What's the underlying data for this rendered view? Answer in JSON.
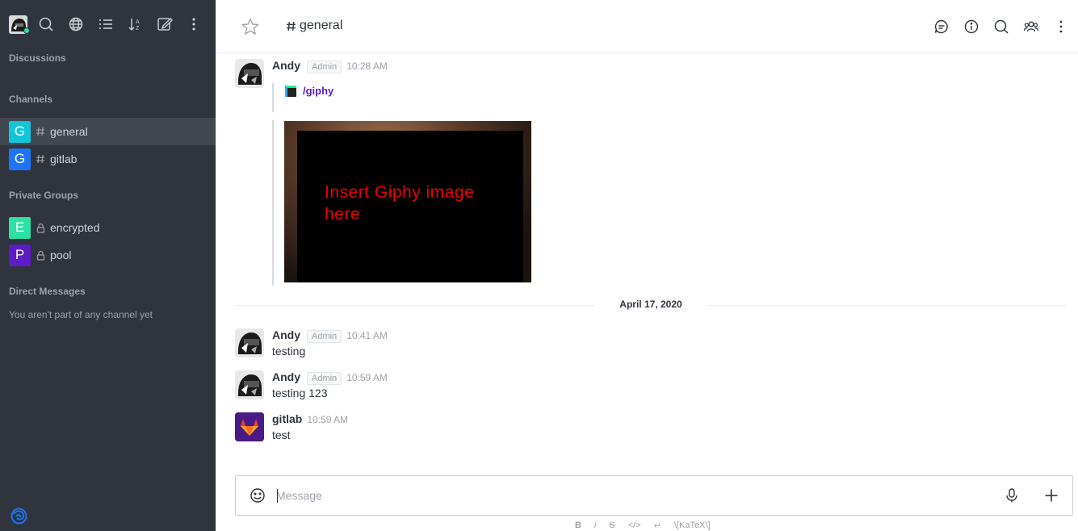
{
  "sidebar": {
    "sections": {
      "discussions": "Discussions",
      "channels": "Channels",
      "private_groups": "Private Groups",
      "direct_messages": "Direct Messages"
    },
    "channels": [
      {
        "badge": "G",
        "label": "general",
        "color": "#12c5d9",
        "active": true
      },
      {
        "badge": "G",
        "label": "gitlab",
        "color": "#1d74f5",
        "active": false
      }
    ],
    "private_groups": [
      {
        "badge": "E",
        "label": "encrypted",
        "color": "#2de0a5"
      },
      {
        "badge": "P",
        "label": "pool",
        "color": "#5c1cc6"
      }
    ],
    "direct_messages_empty": "You aren't part of any channel yet"
  },
  "header": {
    "title": "general",
    "hash": "#"
  },
  "messages": [
    {
      "author": "Andy",
      "role": "Admin",
      "time": "10:28 AM",
      "attachment_link": "/giphy",
      "image_placeholder": "Insert Giphy image here"
    },
    {
      "author": "Andy",
      "role": "Admin",
      "time": "10:41 AM",
      "text": "testing"
    },
    {
      "author": "Andy",
      "role": "Admin",
      "time": "10:59 AM",
      "text": "testing 123"
    },
    {
      "author": "gitlab",
      "time": "10:59 AM",
      "text": "test"
    }
  ],
  "date_divider": "April 17, 2020",
  "composer": {
    "placeholder": "Message",
    "formatting": [
      "B",
      "i",
      "S",
      "</>",
      "↵",
      "\\[KaTeX\\]"
    ]
  },
  "colors": {
    "sidebar_bg": "#2f343d",
    "sidebar_active": "#414852",
    "status_online": "#2de0a5",
    "giphy_purple": "#5b1cc6"
  }
}
